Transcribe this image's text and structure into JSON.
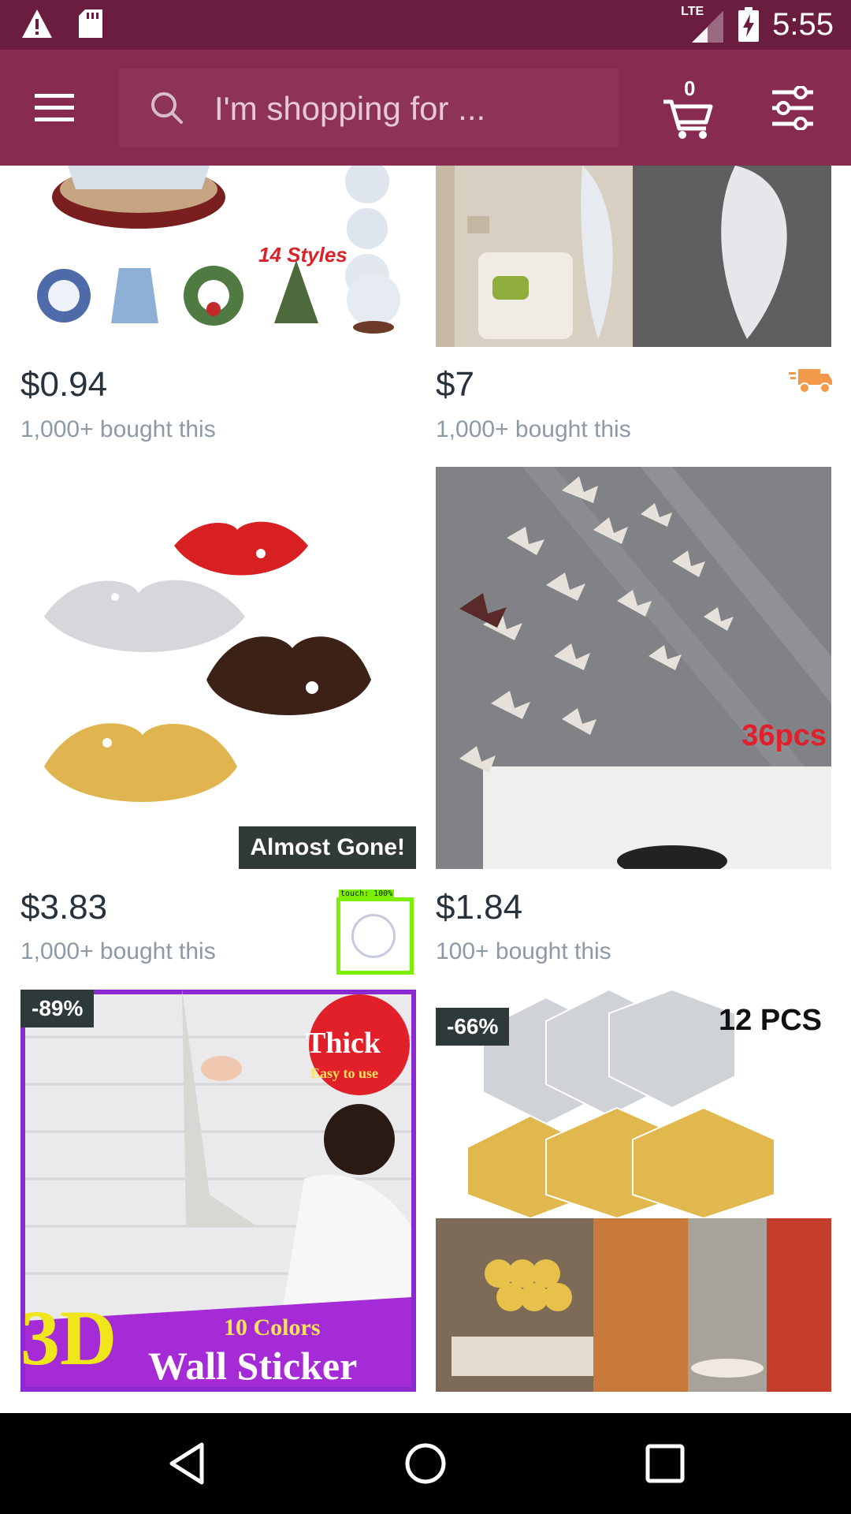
{
  "status_bar": {
    "time": "5:55",
    "network": "LTE",
    "icons": [
      "warning-icon",
      "sd-card-icon",
      "signal-icon",
      "battery-charging-icon"
    ]
  },
  "header": {
    "menu_icon": "hamburger-menu-icon",
    "search_placeholder": "I'm shopping for ...",
    "cart_count": "0",
    "filter_icon": "filter-sliders-icon"
  },
  "products": [
    {
      "price": "$0.94",
      "sold": "1,000+ bought this",
      "image_text": "14 Styles"
    },
    {
      "price": "$7",
      "sold": "1,000+ bought this",
      "shipping_icon": "truck-icon"
    },
    {
      "price": "$3.83",
      "sold": "1,000+ bought this",
      "badge": "Almost Gone!"
    },
    {
      "price": "$1.84",
      "sold": "100+ bought this",
      "image_text": "36pcs"
    },
    {
      "discount": "-89%",
      "image_text": [
        "Thick",
        "Easy to use",
        "3D",
        "10 Colors",
        "Wall Sticker"
      ]
    },
    {
      "discount": "-66%",
      "image_text": "12 PCS"
    }
  ],
  "touch_indicator": {
    "label": "touch: 100%"
  },
  "nav_bar": {
    "buttons": [
      "back-icon",
      "home-icon",
      "recents-icon"
    ]
  }
}
